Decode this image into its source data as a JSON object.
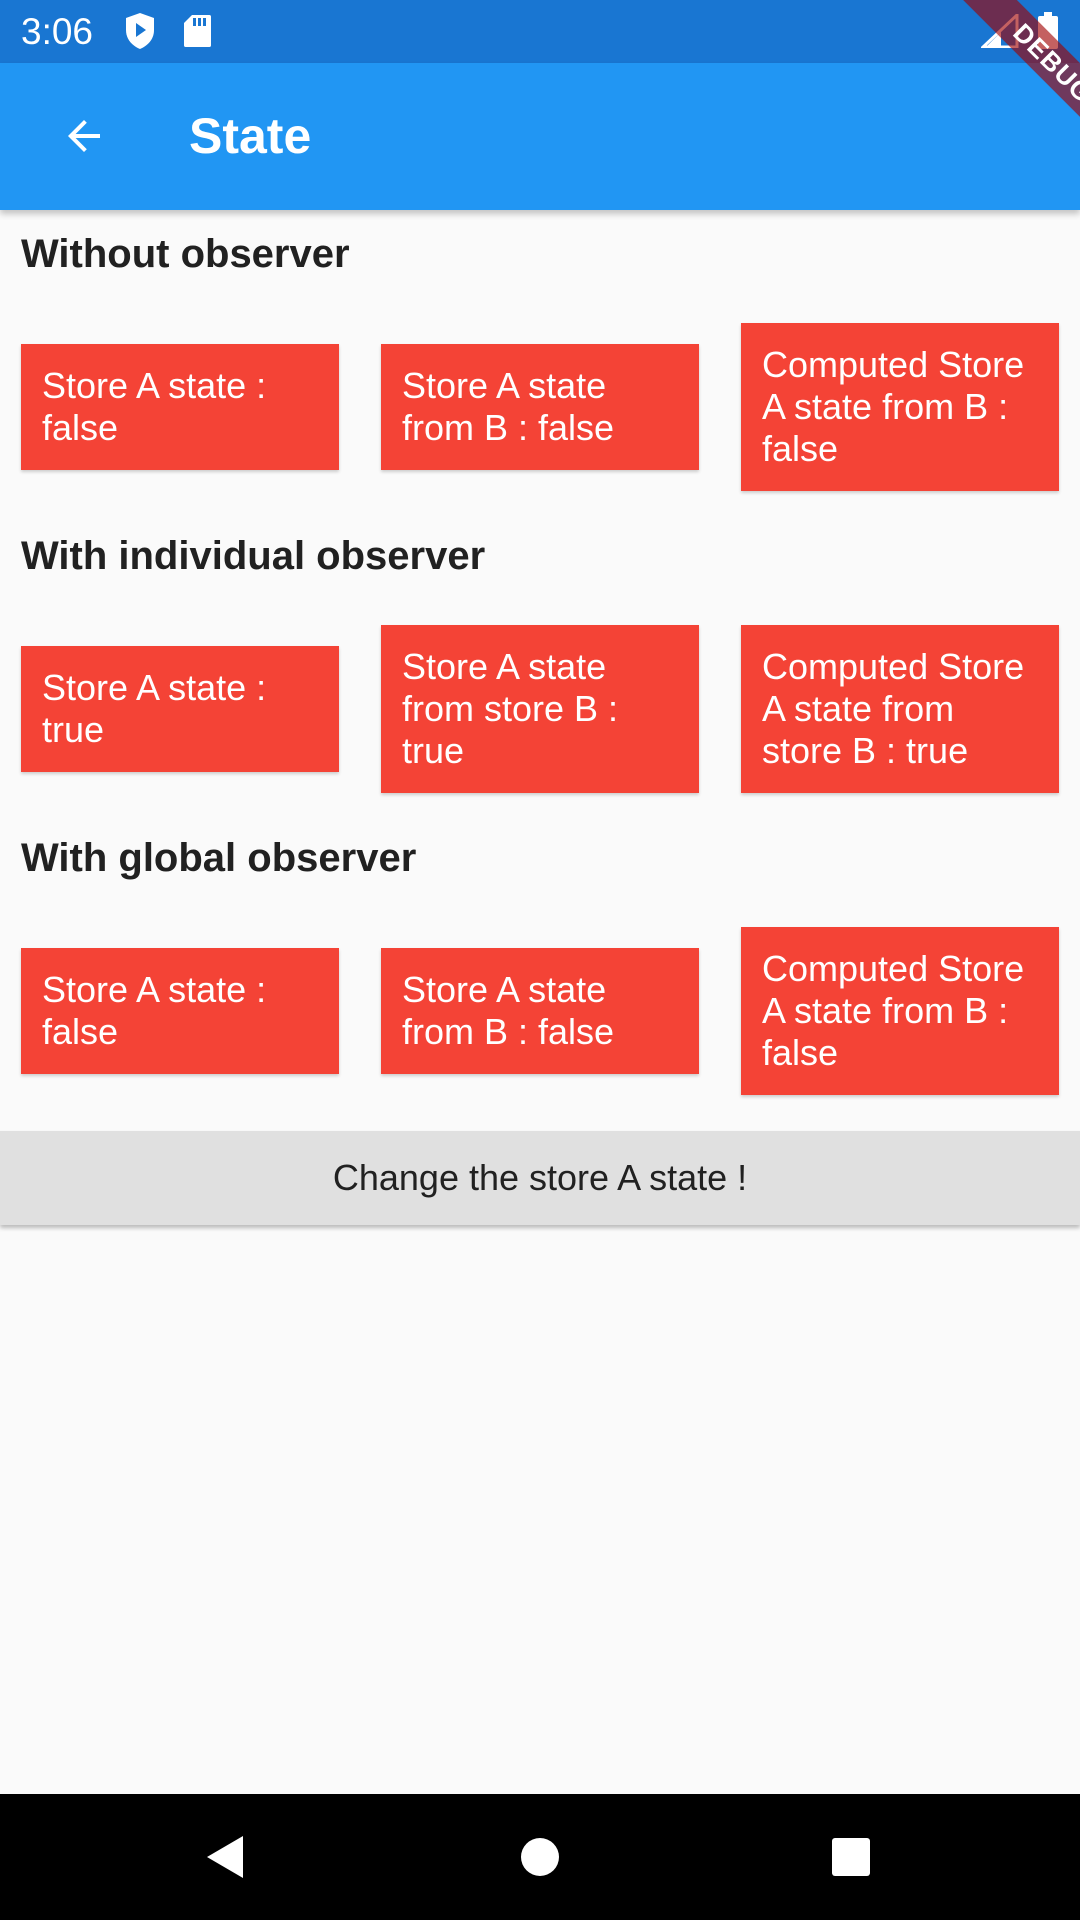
{
  "status_bar": {
    "time": "3:06",
    "icons": [
      "shield-play-icon",
      "sd-card-icon",
      "signal-icon",
      "battery-icon"
    ],
    "color": "#1976d2"
  },
  "app_bar": {
    "title": "State",
    "back_icon": "arrow-left-icon",
    "color": "#2196f3"
  },
  "debug_banner": "DEBUG",
  "sections": [
    {
      "title": "Without observer",
      "boxes": [
        "Store A state  : false",
        "Store A state from B : false",
        "Computed Store A state from B  : false"
      ]
    },
    {
      "title": "With individual observer",
      "boxes": [
        "Store A state : true",
        "Store A state from store B : true",
        "Computed Store A state from store B : true"
      ]
    },
    {
      "title": "With global observer",
      "boxes": [
        "Store A state : false",
        "Store A state from B : false",
        "Computed Store A state from B : false"
      ]
    }
  ],
  "change_button": {
    "label": "Change the store A state !"
  },
  "nav_bar": {
    "icons": [
      "back-triangle-icon",
      "home-circle-icon",
      "recents-square-icon"
    ]
  },
  "colors": {
    "box": "#f44336",
    "background": "#fafafa",
    "button": "#e0e0e0"
  }
}
